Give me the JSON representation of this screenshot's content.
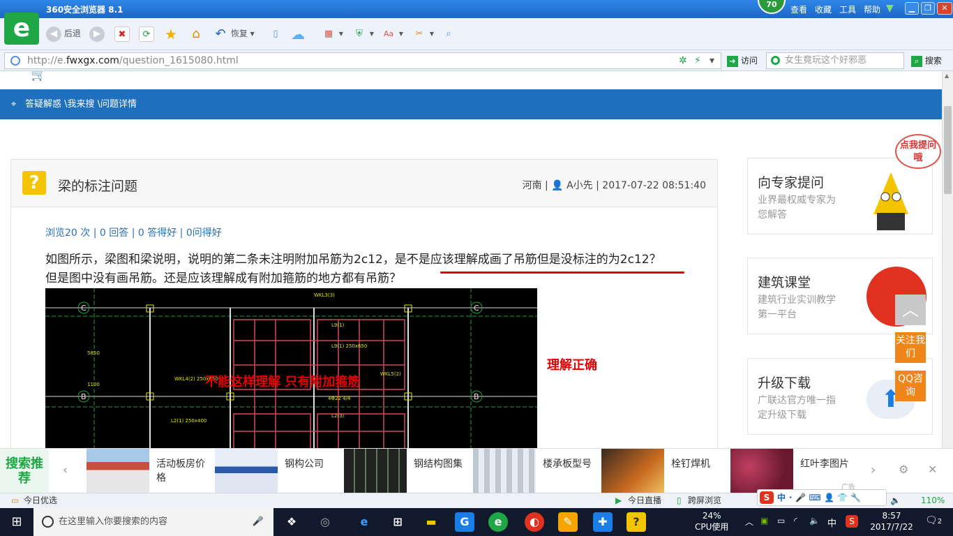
{
  "browser": {
    "title": "360安全浏览器 8.1",
    "level_badge": "70",
    "menu": [
      "查看",
      "收藏",
      "工具",
      "帮助"
    ],
    "clock_label": "8:57",
    "toolbar": {
      "back_label": "后退",
      "restore_label": "恢复"
    },
    "address": {
      "prefix": "http://e.",
      "host": "fwxgx.com",
      "path": "/question_1615080.html"
    },
    "visit_label": "访问",
    "search_placeholder": "女生竟玩这个好邪恶",
    "search_button": "搜索"
  },
  "page": {
    "breadcrumb": "答疑解惑 \\我来搜 \\问题详情",
    "question": {
      "title": "梁的标注问题",
      "meta": "河南 | 👤 A小先 | 2017-07-22 08:51:40",
      "stats": "浏览20 次 | 0 回答 | 0 答得好 | 0问得好",
      "body_line1": "如图所示，梁图和梁说明，说明的第二条未注明附加吊筋为2c12，是不是应该理解成画了吊筋但是没标注的为2c12？",
      "body_line2": "但是图中没有画吊筋。还是应该理解成有附加箍筋的地方都有吊筋？"
    },
    "annotations": {
      "correct": "理解正确",
      "not_this": "不能这样理解 只有附加箍筋"
    },
    "drawing": {
      "axis_labels": [
        "C",
        "B"
      ],
      "beam_labels": [
        "WKL3(3)",
        "L9(1)",
        "L9(1) 250x650",
        "WKL4(2) 250x650",
        "L2(1) 250x400",
        "L2(3)",
        "WKL5(2)",
        "5850",
        "1100",
        "4Φ22 4/4"
      ]
    },
    "sidebar": {
      "ask_expert": {
        "title": "向专家提问",
        "sub": "业界最权威专家为您解答",
        "bubble": "点我提问哦"
      },
      "classroom": {
        "title": "建筑课堂",
        "sub": "建筑行业实训教学第一平台"
      },
      "upgrade": {
        "title": "升级下载",
        "sub": "广联达官方唯一指定升级下载"
      },
      "follow_btn": "关注我们",
      "qq_btn": "QQ咨询"
    }
  },
  "rec_bar": {
    "tag": "搜索推荐",
    "items": [
      {
        "label": "活动板房价格"
      },
      {
        "label": "钢构公司"
      },
      {
        "label": "钢结构图集"
      },
      {
        "label": "楼承板型号"
      },
      {
        "label": "栓钉焊机"
      },
      {
        "label": "红叶李图片"
      }
    ],
    "ad_label": "广告"
  },
  "statusbar": {
    "left": "今日优选",
    "live": "今日直播",
    "screen": "跨屏浏览",
    "zoom": "110%",
    "ime": "中"
  },
  "taskbar": {
    "search_placeholder": "在这里输入你要搜索的内容",
    "cpu_percent": "24%",
    "cpu_label": "CPU使用",
    "lang": "中",
    "time": "8:57",
    "date": "2017/7/22",
    "notif": "2"
  }
}
